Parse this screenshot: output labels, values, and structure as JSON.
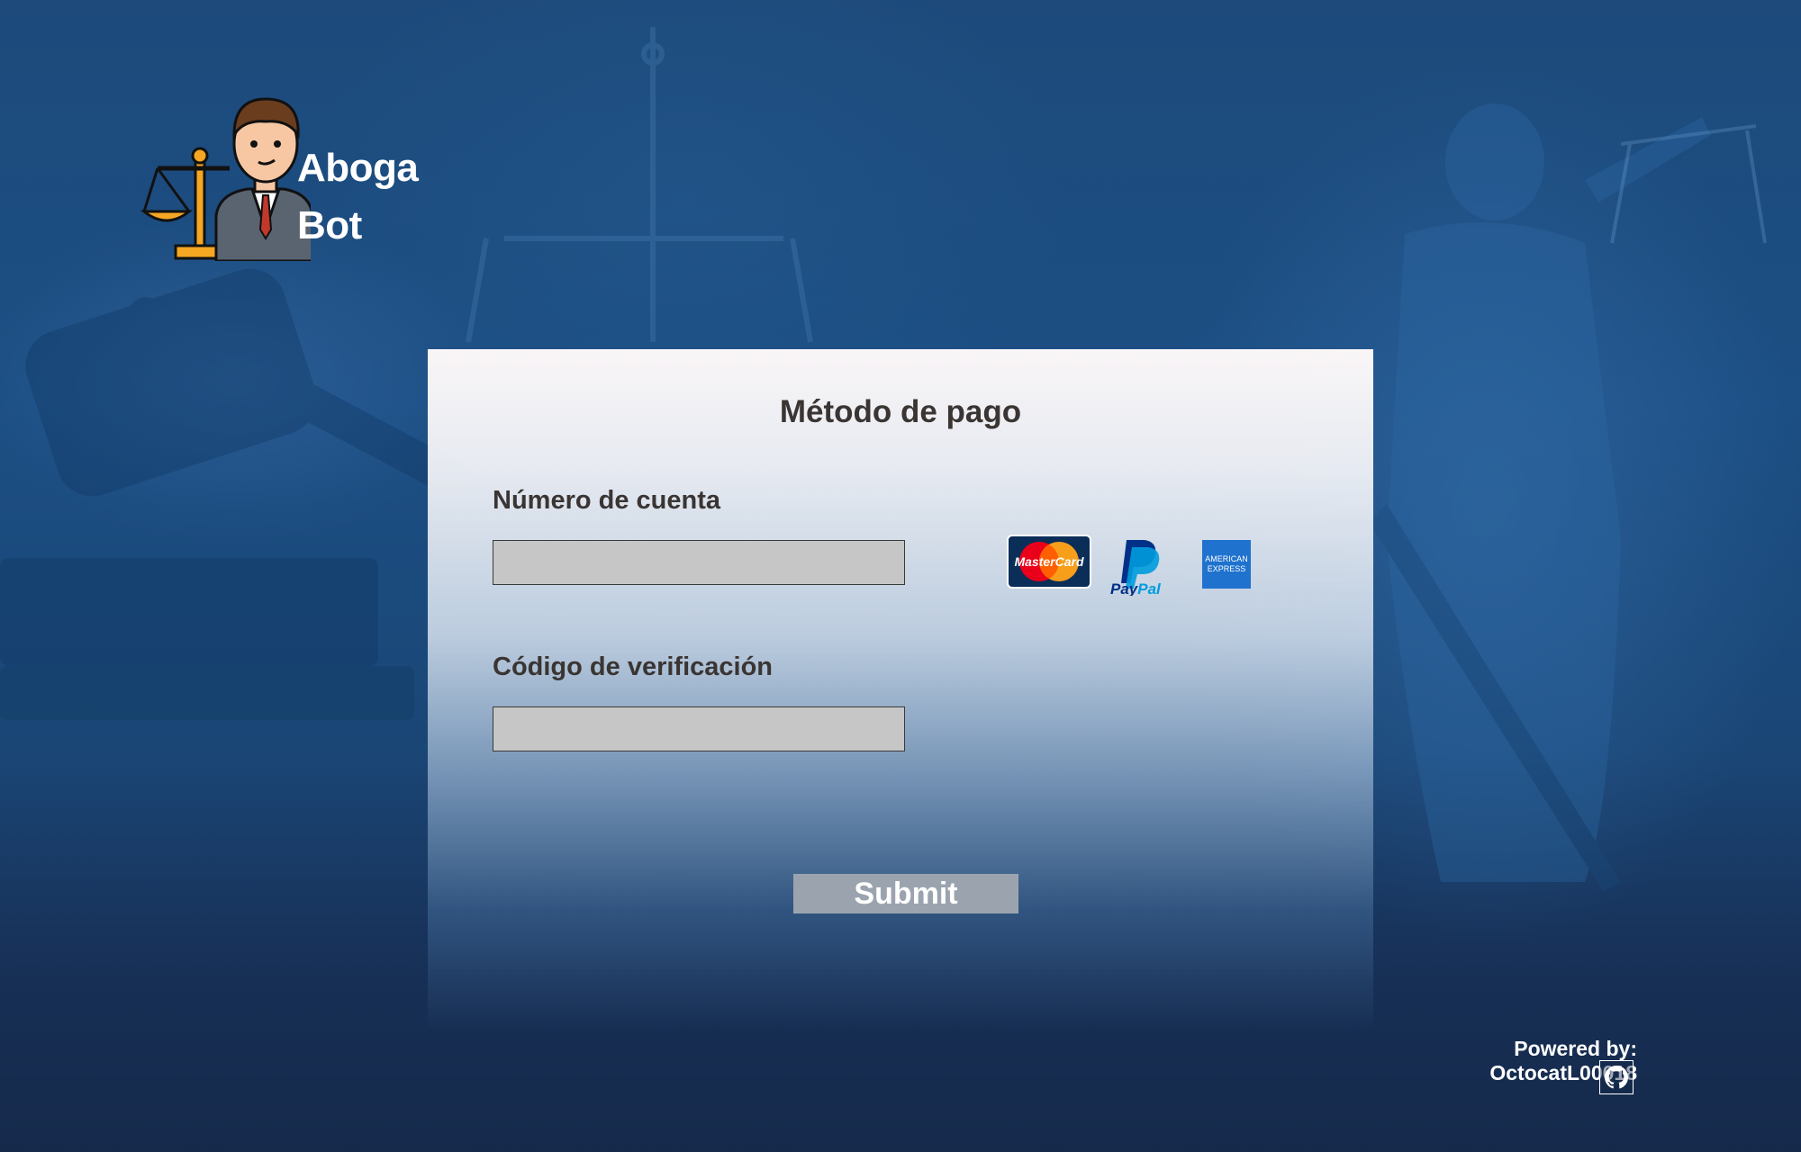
{
  "brand": {
    "name_line1": "Aboga",
    "name_line2": "Bot"
  },
  "payment": {
    "title": "Método de pago",
    "account_label": "Número de cuenta",
    "account_value": "",
    "verification_label": "Código de verificación",
    "verification_value": "",
    "submit_label": "Submit",
    "methods": [
      {
        "name": "MasterCard",
        "icon": "mastercard-icon"
      },
      {
        "name": "PayPal",
        "icon": "paypal-icon"
      },
      {
        "name": "American Express",
        "icon": "amex-icon"
      }
    ]
  },
  "footer": {
    "powered_by": "Powered by: OctocatL00018",
    "icon": "github-icon"
  },
  "colors": {
    "background": "#1c4f84",
    "card_top": "#faf6f7",
    "text": "#3a3533",
    "input_bg": "#c6c6c6",
    "button_bg": "#9ba4ae"
  }
}
